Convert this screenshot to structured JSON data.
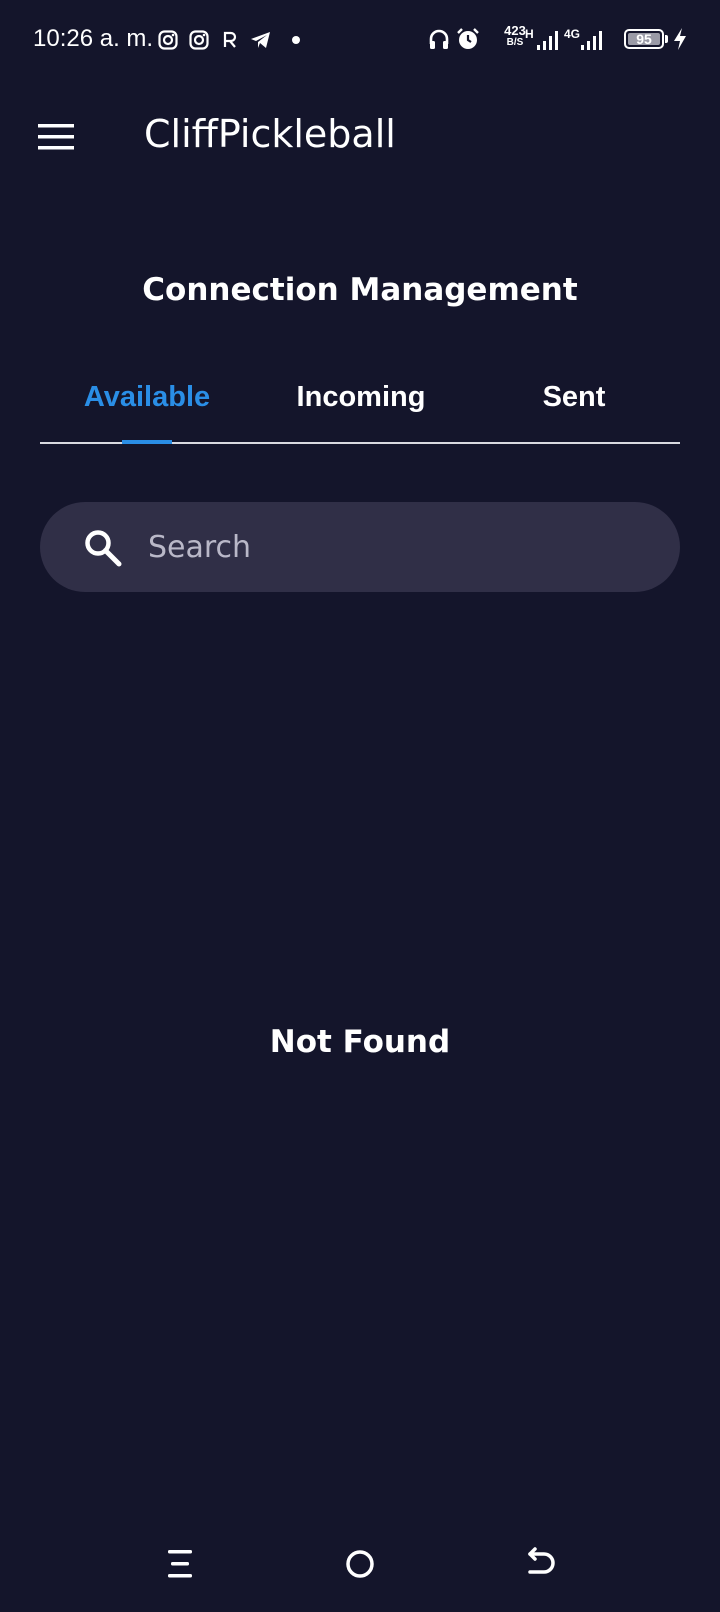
{
  "status_bar": {
    "time": "10:26 a. m.",
    "net_speed_value": "423",
    "net_speed_unit": "B/S",
    "net_type_1": "H",
    "net_type_2": "4G",
    "battery_level": "95",
    "icons": [
      "instagram-icon",
      "instagram-icon",
      "r-app-icon",
      "telegram-icon",
      "dot-icon",
      "headphones-icon",
      "alarm-icon",
      "signal-icon",
      "signal-icon",
      "charging-icon"
    ]
  },
  "app_bar": {
    "title": "CliffPickleball",
    "menu_icon": "hamburger-menu-icon"
  },
  "page": {
    "title": "Connection Management"
  },
  "tabs": {
    "items": [
      {
        "label": "Available",
        "active": true
      },
      {
        "label": "Incoming",
        "active": false
      },
      {
        "label": "Sent",
        "active": false
      }
    ],
    "active_color": "#2a8ee6"
  },
  "search": {
    "placeholder": "Search",
    "value": ""
  },
  "empty_state": {
    "message": "Not Found"
  },
  "nav_bar": {
    "icons": [
      "recents-icon",
      "home-icon",
      "back-icon"
    ]
  },
  "colors": {
    "background": "#14152b",
    "search_background": "#302f47",
    "accent": "#2a8ee6",
    "text": "#ffffff"
  }
}
